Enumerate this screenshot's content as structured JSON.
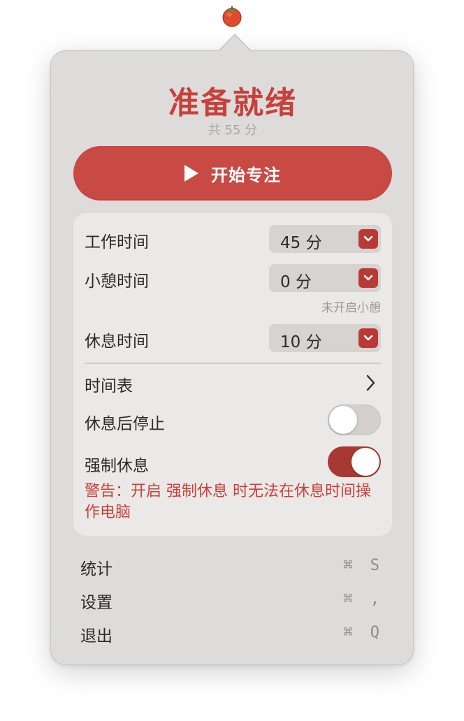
{
  "status_icon": "tomato-icon",
  "header": {
    "title": "准备就绪",
    "subtitle": "共 55 分"
  },
  "start_button": {
    "label": "开始专注",
    "icon": "play-icon"
  },
  "settings": {
    "work_time": {
      "label": "工作时间",
      "value": "45 分"
    },
    "short_break": {
      "label": "小憩时间",
      "value": "0 分",
      "hint": "未开启小憩"
    },
    "rest_time": {
      "label": "休息时间",
      "value": "10 分"
    },
    "schedule": {
      "label": "时间表"
    },
    "stop_after_rest": {
      "label": "休息后停止",
      "enabled": false
    },
    "force_rest": {
      "label": "强制休息",
      "enabled": true
    },
    "warning": "警告：开启 强制休息 时无法在休息时间操作电脑"
  },
  "menu": [
    {
      "label": "统计",
      "shortcut": "⌘ S"
    },
    {
      "label": "设置",
      "shortcut": "⌘ ,"
    },
    {
      "label": "退出",
      "shortcut": "⌘ Q"
    }
  ],
  "colors": {
    "accent": "#c94a44",
    "accent_dark": "#b93a35",
    "panel": "#dedcda",
    "card": "#ebe9e7"
  }
}
